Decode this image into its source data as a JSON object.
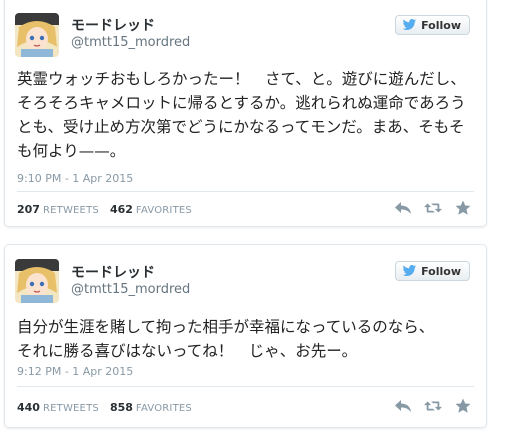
{
  "tweets": [
    {
      "display_name": "モードレッド",
      "screen_name": "@tmtt15_mordred",
      "follow_label": "Follow",
      "text": "英霊ウォッチおもしろかったー！　さて、と。遊びに遊んだし、\nそろそろキャメロットに帰るとするか。逃れられぬ運命であろう\nとも、受け止め方次第でどうにかなるってモンだ。まあ、そもそ\nも何より——。",
      "timestamp": "9:10 PM - 1 Apr 2015",
      "retweets": "207",
      "retweets_label": "RETWEETS",
      "favorites": "462",
      "favorites_label": "FAVORITES"
    },
    {
      "display_name": "モードレッド",
      "screen_name": "@tmtt15_mordred",
      "follow_label": "Follow",
      "text": "自分が生涯を賭して拘った相手が幸福になっているのなら、\nそれに勝る喜びはないってね！　じゃ、お先ー。",
      "timestamp": "9:12 PM - 1 Apr 2015",
      "retweets": "440",
      "retweets_label": "RETWEETS",
      "favorites": "858",
      "favorites_label": "FAVORITES"
    }
  ],
  "icons": {
    "follow": "twitter-bird-icon",
    "reply": "reply-icon",
    "retweet": "retweet-icon",
    "favorite": "star-icon"
  },
  "colors": {
    "twitter_blue": "#55acee",
    "action_gray": "#8899a6",
    "border": "#e1e8ed"
  }
}
